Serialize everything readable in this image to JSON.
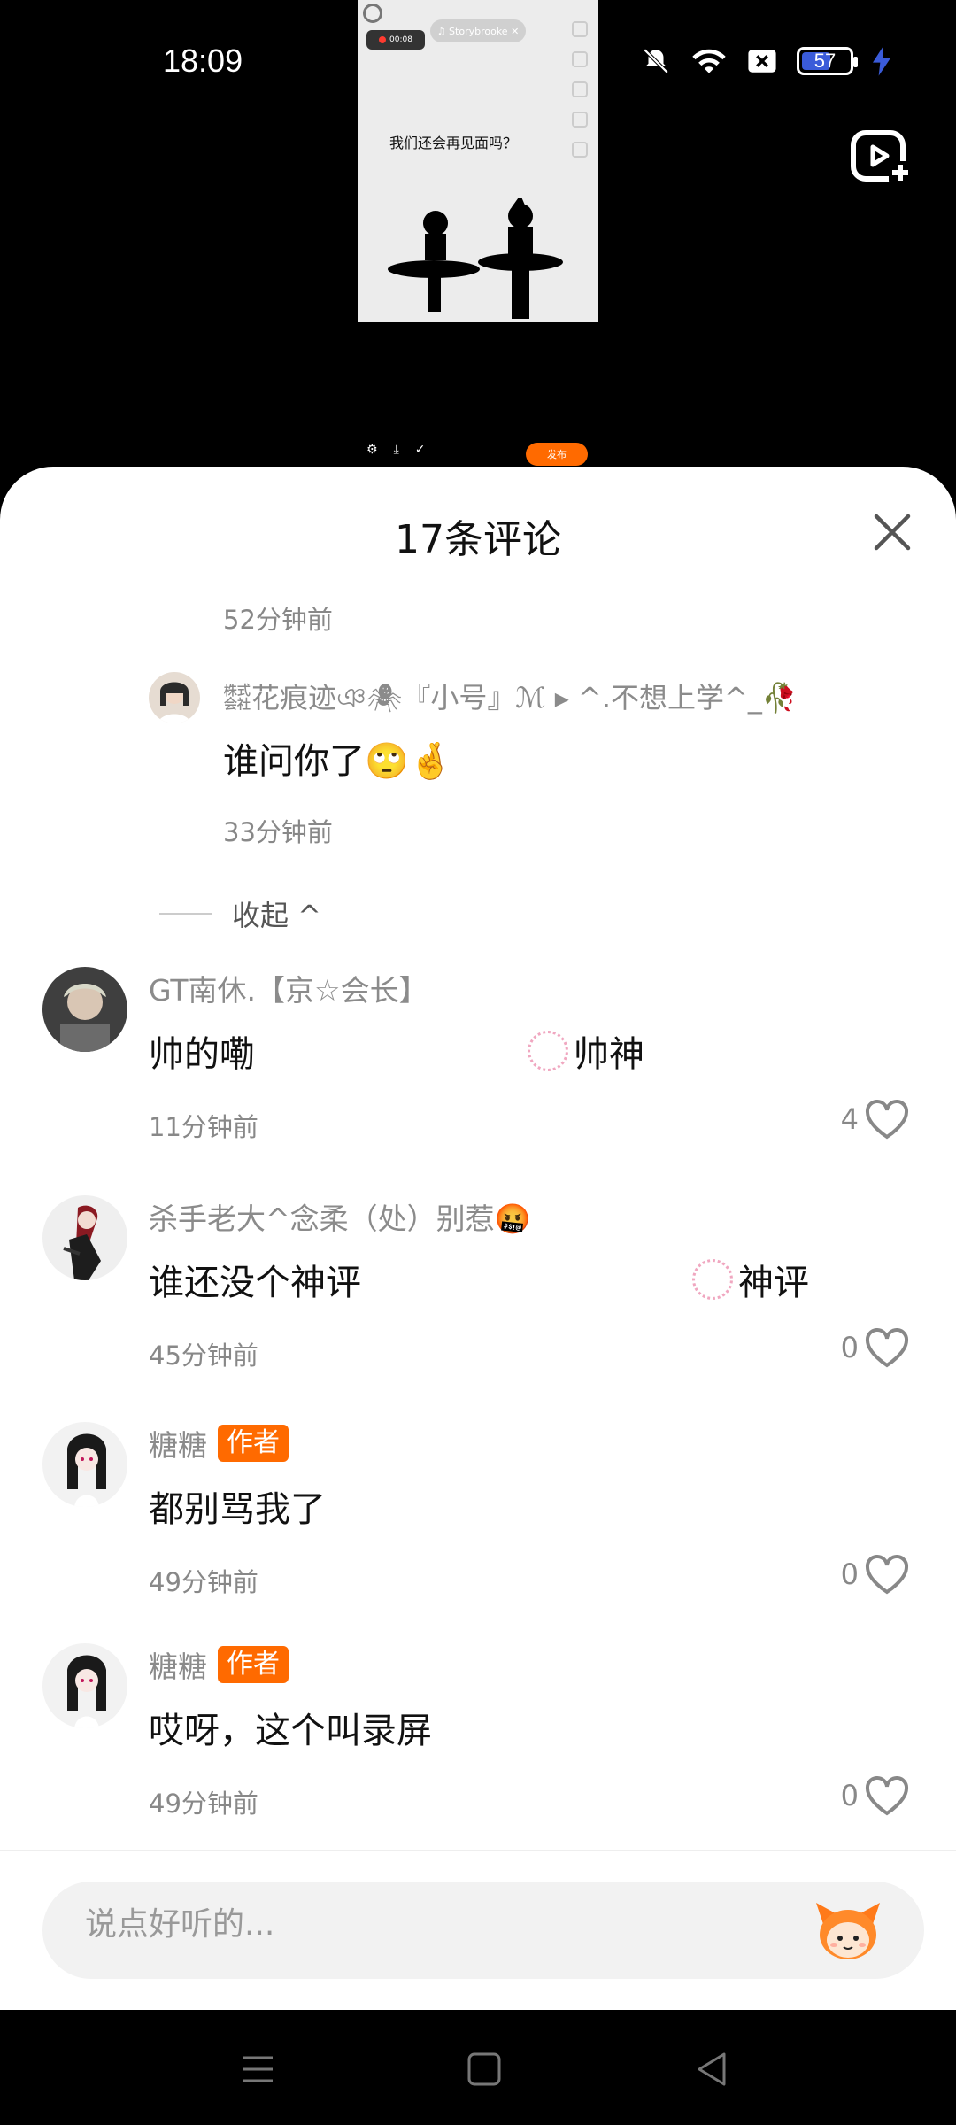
{
  "status_bar": {
    "time": "18:09",
    "battery": "57",
    "icons": [
      "bell-mute-icon",
      "wifi-icon",
      "sim-x-icon",
      "battery-icon",
      "charging-icon"
    ]
  },
  "preview": {
    "caption": "我们还会再见面吗？",
    "music_pill": "♫ Storybrooke ✕",
    "rec_time": "00:08",
    "publish": "发布"
  },
  "sheet": {
    "title": "17条评论",
    "first_time": "52分钟前",
    "reply": {
      "user": "㍿花痕迹ঞ🕷『小号』ℳ ▸ ^.不想上学^_🥀",
      "text": "谁问你了🙄🤞",
      "time": "33分钟前"
    },
    "collapse_label": "收起 ^",
    "comments": [
      {
        "user": "GT南休.【京☆会长】",
        "text": "帅的嘞",
        "tag": "帅神",
        "time": "11分钟前",
        "likes": "4"
      },
      {
        "user": "杀手老大^念柔（处）别惹🤬",
        "text": "谁还没个神评",
        "tag": "神评",
        "time": "45分钟前",
        "likes": "0"
      },
      {
        "user": "糖糖",
        "badge": "作者",
        "text": "都别骂我了",
        "time": "49分钟前",
        "likes": "0"
      },
      {
        "user": "糖糖",
        "badge": "作者",
        "text": "哎呀，这个叫录屏",
        "time": "49分钟前",
        "likes": "0"
      }
    ],
    "input_placeholder": "说点好听的..."
  }
}
